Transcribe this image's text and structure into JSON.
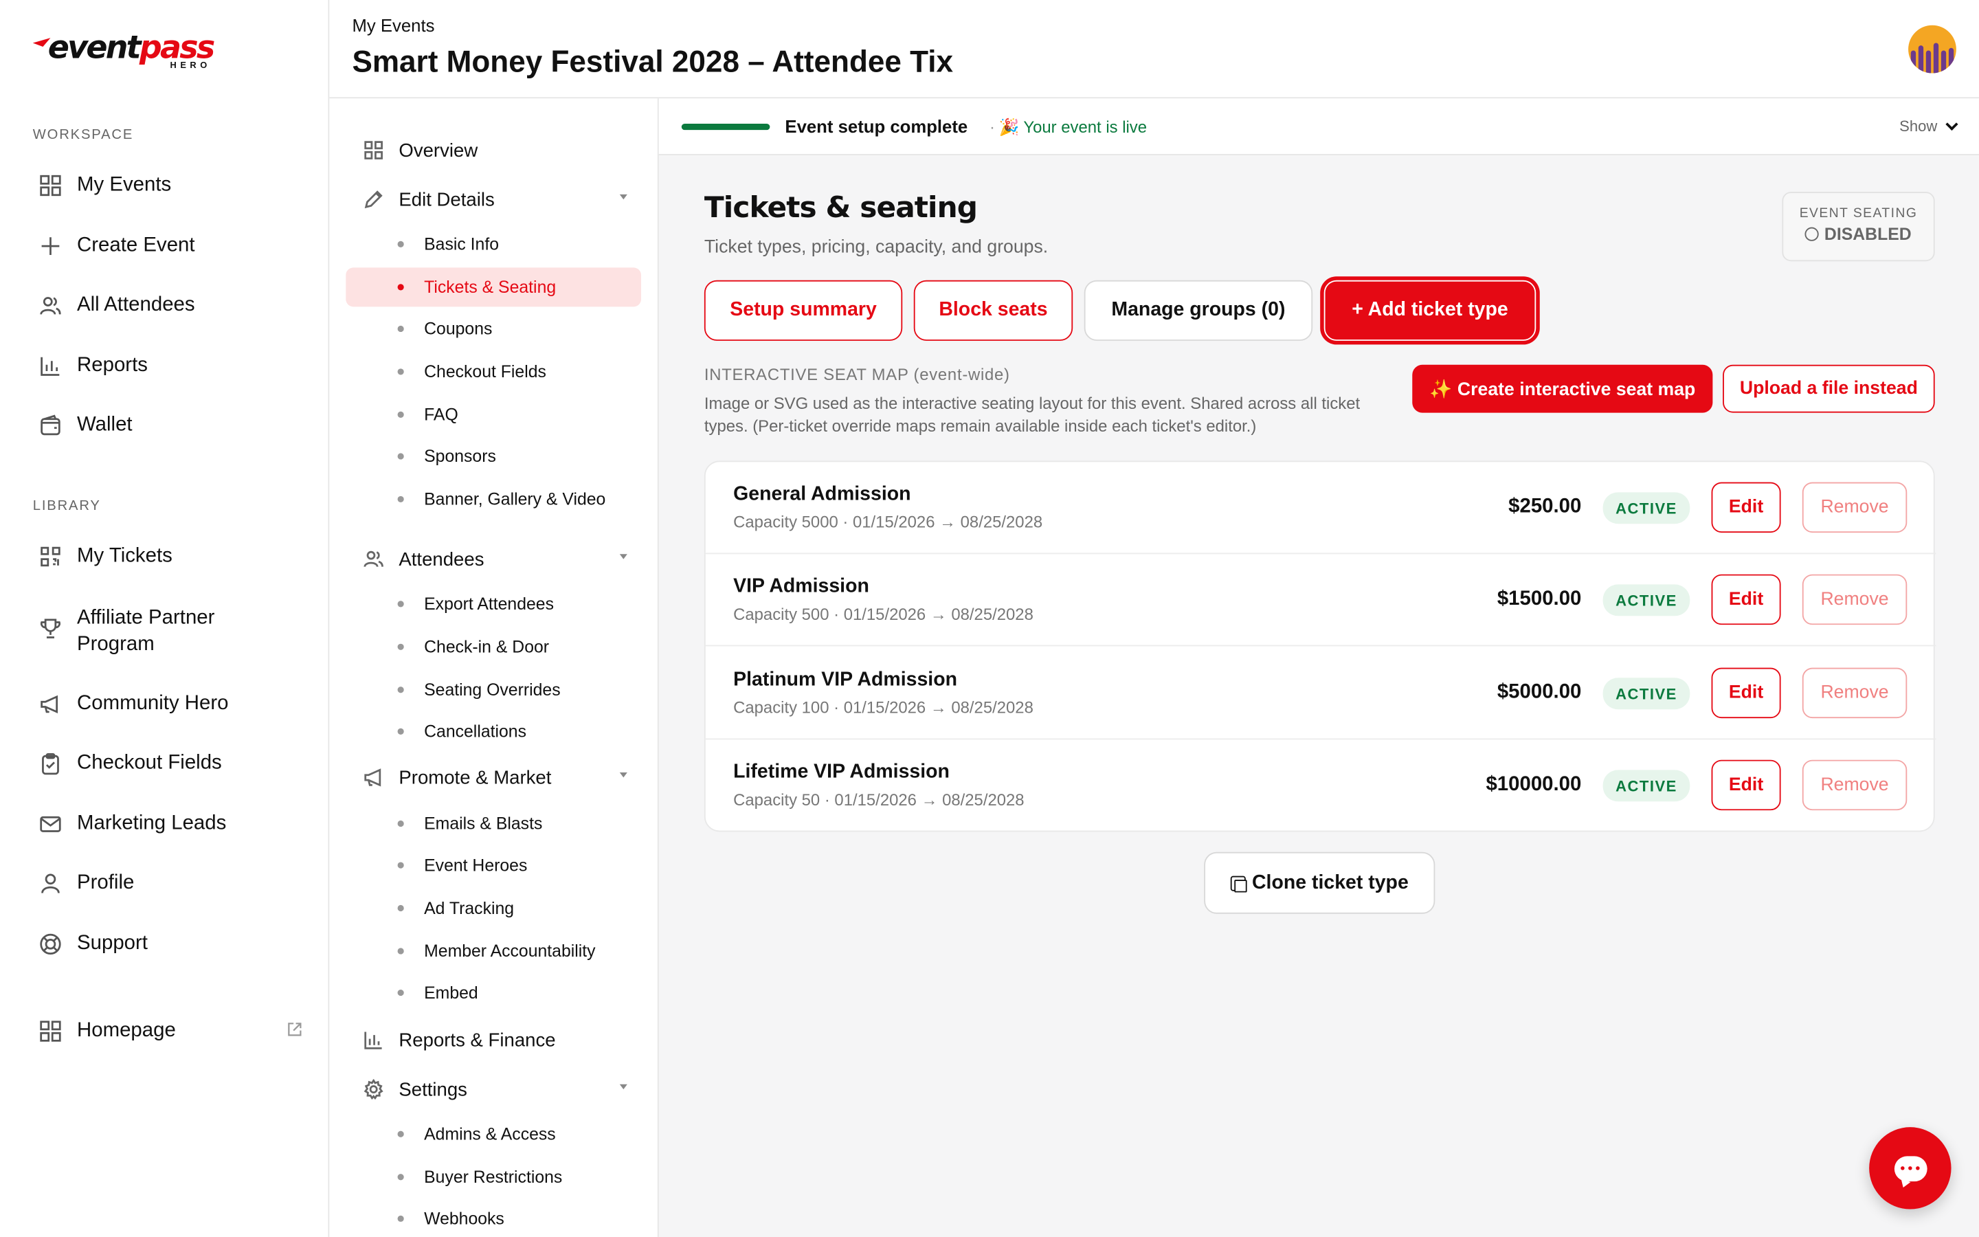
{
  "brand": {
    "logo_main": "event",
    "logo_accent": "pass",
    "logo_sub": "HERO",
    "accent": "#e50914"
  },
  "sidebar": {
    "workspace_label": "WORKSPACE",
    "library_label": "LIBRARY",
    "workspace_items": [
      {
        "label": "My Events",
        "icon": "grid-icon"
      },
      {
        "label": "Create Event",
        "icon": "plus-icon"
      },
      {
        "label": "All Attendees",
        "icon": "users-icon"
      },
      {
        "label": "Reports",
        "icon": "bar-chart-icon"
      },
      {
        "label": "Wallet",
        "icon": "wallet-icon"
      }
    ],
    "library_items": [
      {
        "label": "My Tickets",
        "icon": "qr-icon"
      },
      {
        "label": "Affiliate Partner Program",
        "icon": "trophy-icon"
      },
      {
        "label": "Community Hero",
        "icon": "megaphone-icon"
      },
      {
        "label": "Checkout Fields",
        "icon": "clipboard-icon"
      },
      {
        "label": "Marketing Leads",
        "icon": "mail-icon"
      },
      {
        "label": "Profile",
        "icon": "user-icon"
      },
      {
        "label": "Support",
        "icon": "lifebuoy-icon"
      }
    ],
    "homepage": {
      "label": "Homepage",
      "icon": "grid-icon"
    }
  },
  "header": {
    "breadcrumb": "My Events",
    "title": "Smart Money Festival 2028 – Attendee Tix"
  },
  "subnav": {
    "overview": "Overview",
    "edit_details": "Edit Details",
    "edit_items": [
      "Basic Info",
      "Tickets & Seating",
      "Coupons",
      "Checkout Fields",
      "FAQ",
      "Sponsors",
      "Banner, Gallery & Video"
    ],
    "attendees": "Attendees",
    "attendee_items": [
      "Export Attendees",
      "Check-in & Door",
      "Seating Overrides",
      "Cancellations"
    ],
    "promote": "Promote & Market",
    "promote_items": [
      "Emails & Blasts",
      "Event Heroes",
      "Ad Tracking",
      "Member Accountability",
      "Embed"
    ],
    "reports": "Reports & Finance",
    "settings": "Settings",
    "settings_items": [
      "Admins & Access",
      "Buyer Restrictions",
      "Webhooks"
    ]
  },
  "status": {
    "setup": "Event setup complete",
    "live": "🎉 Your event is live",
    "separator": "·",
    "show": "Show",
    "progress": 1.0
  },
  "section": {
    "title": "Tickets & seating",
    "subtitle": "Ticket types, pricing, capacity, and groups.",
    "seating_label": "EVENT SEATING",
    "seating_value": "DISABLED",
    "buttons": {
      "setup_summary": "Setup summary",
      "block_seats": "Block seats",
      "manage_groups": "Manage groups (0)",
      "add_ticket": "+ Add ticket type"
    },
    "seatmap_label": "INTERACTIVE SEAT MAP (event-wide)",
    "seatmap_desc": "Image or SVG used as the interactive seating layout for this event. Shared across all ticket types. (Per-ticket override maps remain available inside each ticket's editor.)",
    "create_map": "✨ Create interactive seat map",
    "upload_file": "Upload a file instead",
    "clone": "Clone ticket type"
  },
  "tickets": [
    {
      "name": "General Admission",
      "meta": "Capacity 5000 · 01/15/2026 → 08/25/2028",
      "price": "$250.00",
      "status": "ACTIVE",
      "edit": "Edit",
      "remove": "Remove"
    },
    {
      "name": "VIP Admission",
      "meta": "Capacity 500 · 01/15/2026 → 08/25/2028",
      "price": "$1500.00",
      "status": "ACTIVE",
      "edit": "Edit",
      "remove": "Remove"
    },
    {
      "name": "Platinum VIP Admission",
      "meta": "Capacity 100 · 01/15/2026 → 08/25/2028",
      "price": "$5000.00",
      "status": "ACTIVE",
      "edit": "Edit",
      "remove": "Remove"
    },
    {
      "name": "Lifetime VIP Admission",
      "meta": "Capacity 50 · 01/15/2026 → 08/25/2028",
      "price": "$10000.00",
      "status": "ACTIVE",
      "edit": "Edit",
      "remove": "Remove"
    }
  ]
}
